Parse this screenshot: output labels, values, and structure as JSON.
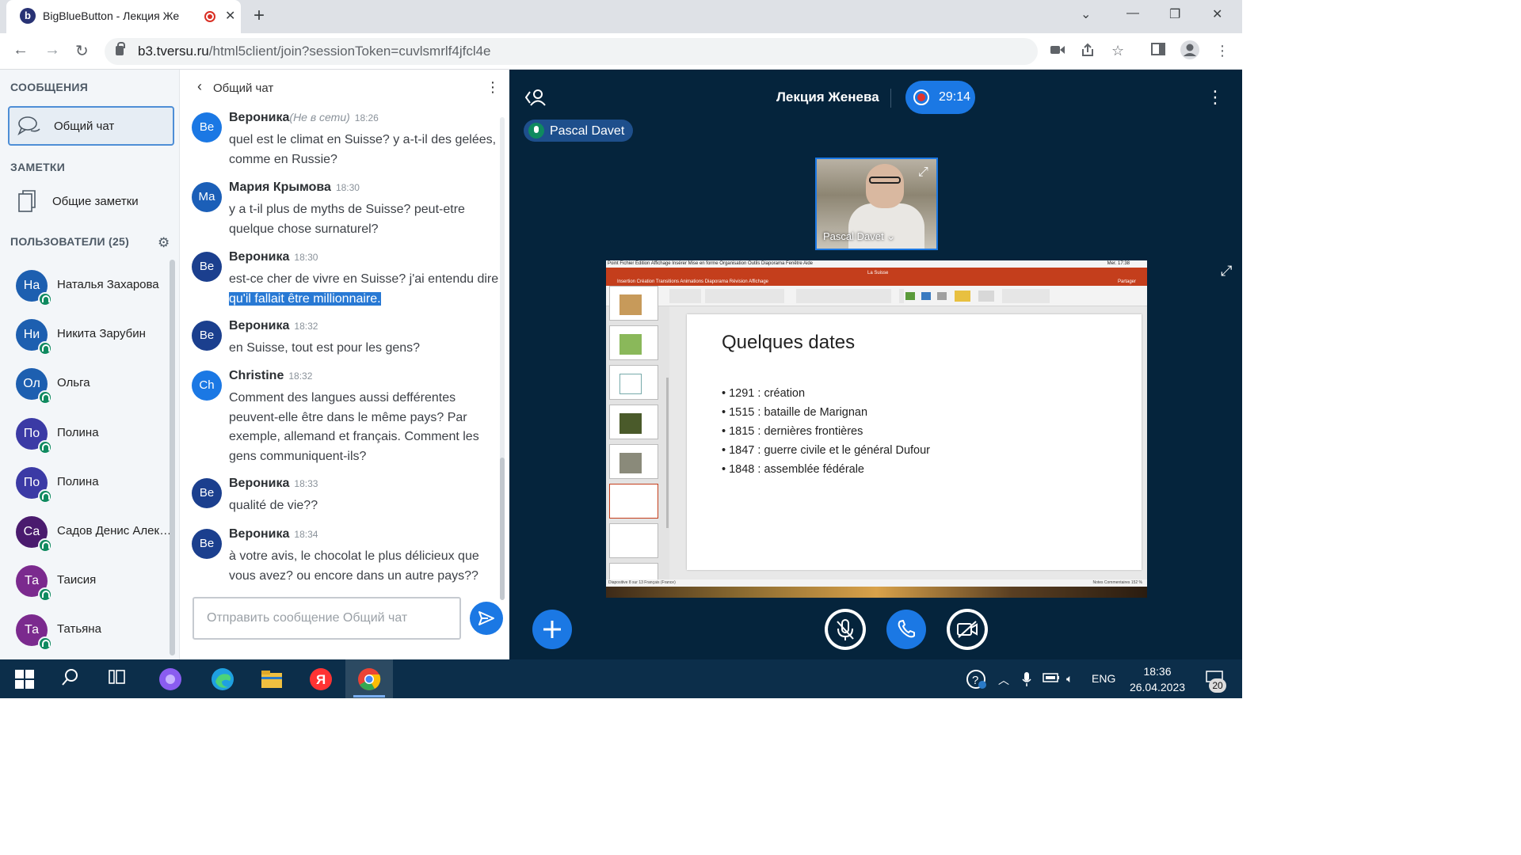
{
  "browser": {
    "tab_title": "BigBlueButton - Лекция Же",
    "favicon_letter": "b",
    "url_host": "b3.tversu.ru",
    "url_path": "/html5client/join?sessionToken=cuvlsmrlf4jfcl4e"
  },
  "nav": {
    "messages_heading": "СООБЩЕНИЯ",
    "public_chat": "Общий чат",
    "notes_heading": "ЗАМЕТКИ",
    "shared_notes": "Общие заметки",
    "users_heading": "ПОЛЬЗОВАТЕЛИ (25)",
    "users": [
      {
        "initials": "На",
        "name": "Наталья Захарова",
        "color": "#1d5fb0"
      },
      {
        "initials": "Ни",
        "name": "Никита Зарубин",
        "color": "#1d5fb0"
      },
      {
        "initials": "Ол",
        "name": "Ольга",
        "color": "#1d5fb0"
      },
      {
        "initials": "По",
        "name": "Полина",
        "color": "#3b3aa5"
      },
      {
        "initials": "По",
        "name": "Полина",
        "color": "#3b3aa5"
      },
      {
        "initials": "Са",
        "name": "Садов Денис Александрович",
        "color": "#4a1b6e"
      },
      {
        "initials": "Та",
        "name": "Таисия",
        "color": "#7b2a8e"
      },
      {
        "initials": "Та",
        "name": "Татьяна",
        "color": "#7b2a8e"
      }
    ]
  },
  "chat": {
    "title": "Общий чат",
    "messages": [
      {
        "initials": "Ве",
        "author": "Вероника",
        "status": "(Не в сети)",
        "time": "18:26",
        "text": "quel est le climat en Suisse? y a-t-il des gelées, comme en Russie?",
        "color": "#1b78e4"
      },
      {
        "initials": "Ма",
        "author": "Мария Крымова",
        "time": "18:30",
        "text": "y a t-il plus de myths de Suisse? peut-etre quelque chose surnaturel?",
        "color": "#1b5fb8"
      },
      {
        "initials": "Ве",
        "author": "Вероника",
        "time": "18:30",
        "text": "est-ce cher de vivre en Suisse? j'ai entendu dire ",
        "highlight": "qu'il fallait être millionnaire.",
        "color": "#1b3f8e"
      },
      {
        "initials": "Ве",
        "author": "Вероника",
        "time": "18:32",
        "text": "en Suisse, tout est pour les gens?",
        "color": "#1b3f8e"
      },
      {
        "initials": "Ch",
        "author": "Christine",
        "time": "18:32",
        "text": "Comment des langues aussi defférentes peuvent-elle être dans le même pays? Par exemple, allemand et français. Comment les gens communiquent-ils?",
        "color": "#1b78e4"
      },
      {
        "initials": "Ве",
        "author": "Вероника",
        "time": "18:33",
        "text": "qualité de vie??",
        "color": "#1b3f8e"
      },
      {
        "initials": "Ве",
        "author": "Вероника",
        "time": "18:34",
        "text": "à votre avis, le chocolat le plus délicieux que vous avez? ou encore dans un autre pays??",
        "color": "#1b3f8e"
      }
    ],
    "input_placeholder": "Отправить сообщение Общий чат"
  },
  "stage": {
    "meeting_title": "Лекция Женева",
    "recording_time": "29:14",
    "talker": "Pascal Davet",
    "webcam_name": "Pascal Davet ⌄"
  },
  "ppt": {
    "menubar": "Point   Fichier   Édition   Affichage   Insérer   Mise en forme   Organisation   Outils   Diaporama   Fenêtre   Aide",
    "status_bar": "Mer. 17:38",
    "file_title": "La Suisse",
    "ribbon_tabs": "Insertion   Création   Transitions   Animations   Diaporama   Révision   Affichage",
    "share_label": "Partager",
    "slide_title": "Quelques dates",
    "bullets": [
      "1291 : création",
      "1515 : bataille de Marignan",
      "1815 : dernières frontières",
      "1847 : guerre civile et le général Dufour",
      "1848 : assemblée fédérale"
    ],
    "statusbar_left": "Diapositive 8 sur 13     Français (France)",
    "statusbar_right": "Notes   Commentaires   152 %"
  },
  "taskbar": {
    "lang": "ENG",
    "time": "18:36",
    "date": "26.04.2023",
    "notifications": "20"
  },
  "colors": {
    "accent": "#1b78e4",
    "stage_bg": "#05243c",
    "taskbar_bg": "#0c2e4a",
    "ppt_red": "#c43e1c"
  }
}
